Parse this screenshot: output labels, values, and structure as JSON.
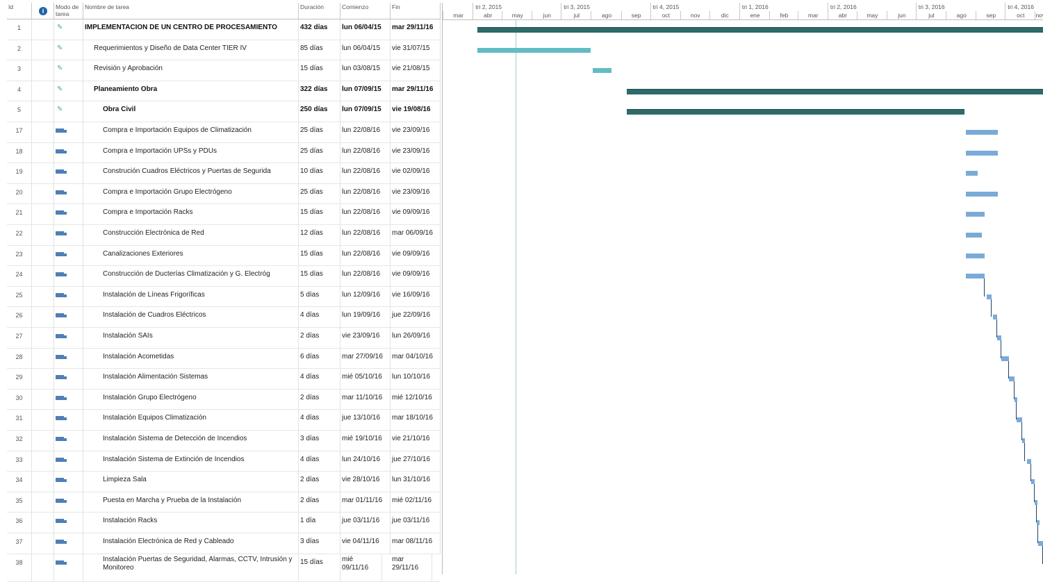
{
  "headers": {
    "id": "Id",
    "info": "",
    "mode": "Modo de tarea",
    "name": "Nombre de tarea",
    "duration": "Duración",
    "start": "Comienzo",
    "end": "Fin"
  },
  "timescale": {
    "quarters": [
      "tri 2, 2015",
      "tri 3, 2015",
      "tri 4, 2015",
      "tri 1, 2016",
      "tri 2, 2016",
      "tri 3, 2016",
      "tri 4, 2016"
    ],
    "months": [
      "mar",
      "abr",
      "may",
      "jun",
      "jul",
      "ago",
      "sep",
      "oct",
      "nov",
      "dic",
      "ene",
      "feb",
      "mar",
      "abr",
      "may",
      "jun",
      "jul",
      "ago",
      "sep",
      "oct",
      "nov"
    ]
  },
  "tasks": [
    {
      "id": "1",
      "mode": "manual",
      "name": "IMPLEMENTACION DE UN CENTRO DE PROCESAMIENTO",
      "duration": "432 días",
      "start": "lun 06/04/15",
      "end": "mar 29/11/16",
      "level": 0,
      "bold": true
    },
    {
      "id": "2",
      "mode": "manual",
      "name": "Requerimientos y Diseño de Data Center TIER IV",
      "duration": "85 días",
      "start": "lun 06/04/15",
      "end": "vie 31/07/15",
      "level": 1,
      "bold": false
    },
    {
      "id": "3",
      "mode": "manual",
      "name": "Revisión y Aprobación",
      "duration": "15 días",
      "start": "lun 03/08/15",
      "end": "vie 21/08/15",
      "level": 1,
      "bold": false
    },
    {
      "id": "4",
      "mode": "manual",
      "name": "Planeamiento Obra",
      "duration": "322 días",
      "start": "lun 07/09/15",
      "end": "mar 29/11/16",
      "level": 1,
      "bold": true
    },
    {
      "id": "5",
      "mode": "manual",
      "name": "Obra Civil",
      "duration": "250 días",
      "start": "lun 07/09/15",
      "end": "vie 19/08/16",
      "level": 2,
      "bold": true
    },
    {
      "id": "17",
      "mode": "auto",
      "name": "Compra e Importación Equipos de Climatización",
      "duration": "25 días",
      "start": "lun 22/08/16",
      "end": "vie 23/09/16",
      "level": 2,
      "bold": false
    },
    {
      "id": "18",
      "mode": "auto",
      "name": "Compra e Importación UPSs y PDUs",
      "duration": "25 días",
      "start": "lun 22/08/16",
      "end": "vie 23/09/16",
      "level": 2,
      "bold": false
    },
    {
      "id": "19",
      "mode": "auto",
      "name": "Construción Cuadros Eléctricos y Puertas de Segurida",
      "duration": "10 días",
      "start": "lun 22/08/16",
      "end": "vie 02/09/16",
      "level": 2,
      "bold": false
    },
    {
      "id": "20",
      "mode": "auto",
      "name": "Compra e Importación Grupo Electrógeno",
      "duration": "25 días",
      "start": "lun 22/08/16",
      "end": "vie 23/09/16",
      "level": 2,
      "bold": false
    },
    {
      "id": "21",
      "mode": "auto",
      "name": "Compra e Importación Racks",
      "duration": "15 días",
      "start": "lun 22/08/16",
      "end": "vie 09/09/16",
      "level": 2,
      "bold": false
    },
    {
      "id": "22",
      "mode": "auto",
      "name": "Construcción Electrónica de Red",
      "duration": "12 días",
      "start": "lun 22/08/16",
      "end": "mar 06/09/16",
      "level": 2,
      "bold": false
    },
    {
      "id": "23",
      "mode": "auto",
      "name": "Canalizaciones Exteriores",
      "duration": "15 días",
      "start": "lun 22/08/16",
      "end": "vie 09/09/16",
      "level": 2,
      "bold": false
    },
    {
      "id": "24",
      "mode": "auto",
      "name": "Construcción de Ducterías Climatización y G. Electróg",
      "duration": "15 días",
      "start": "lun 22/08/16",
      "end": "vie 09/09/16",
      "level": 2,
      "bold": false
    },
    {
      "id": "25",
      "mode": "auto",
      "name": "Instalación de Líneas Frigoríficas",
      "duration": "5 días",
      "start": "lun 12/09/16",
      "end": "vie 16/09/16",
      "level": 2,
      "bold": false
    },
    {
      "id": "26",
      "mode": "auto",
      "name": "Instalación de Cuadros Eléctricos",
      "duration": "4 días",
      "start": "lun 19/09/16",
      "end": "jue 22/09/16",
      "level": 2,
      "bold": false
    },
    {
      "id": "27",
      "mode": "auto",
      "name": "Instalación SAIs",
      "duration": "2 días",
      "start": "vie 23/09/16",
      "end": "lun 26/09/16",
      "level": 2,
      "bold": false
    },
    {
      "id": "28",
      "mode": "auto",
      "name": "Instalación Acometidas",
      "duration": "6 días",
      "start": "mar 27/09/16",
      "end": "mar 04/10/16",
      "level": 2,
      "bold": false
    },
    {
      "id": "29",
      "mode": "auto",
      "name": "Instalación Alimentación Sistemas",
      "duration": "4 días",
      "start": "mié 05/10/16",
      "end": "lun 10/10/16",
      "level": 2,
      "bold": false
    },
    {
      "id": "30",
      "mode": "auto",
      "name": "Instalación Grupo Electrógeno",
      "duration": "2 días",
      "start": "mar 11/10/16",
      "end": "mié 12/10/16",
      "level": 2,
      "bold": false
    },
    {
      "id": "31",
      "mode": "auto",
      "name": "Instalación Equipos Climatización",
      "duration": "4 días",
      "start": "jue 13/10/16",
      "end": "mar 18/10/16",
      "level": 2,
      "bold": false
    },
    {
      "id": "32",
      "mode": "auto",
      "name": "Instalación Sistema de Detección de Incendios",
      "duration": "3 días",
      "start": "mié 19/10/16",
      "end": "vie 21/10/16",
      "level": 2,
      "bold": false
    },
    {
      "id": "33",
      "mode": "auto",
      "name": "Instalación Sistema de Extinción de Incendios",
      "duration": "4 días",
      "start": "lun 24/10/16",
      "end": "jue 27/10/16",
      "level": 2,
      "bold": false
    },
    {
      "id": "34",
      "mode": "auto",
      "name": "Limpieza Sala",
      "duration": "2 días",
      "start": "vie 28/10/16",
      "end": "lun 31/10/16",
      "level": 2,
      "bold": false
    },
    {
      "id": "35",
      "mode": "auto",
      "name": "Puesta en Marcha y Prueba de la Instalación",
      "duration": "2 días",
      "start": "mar 01/11/16",
      "end": "mié 02/11/16",
      "level": 2,
      "bold": false
    },
    {
      "id": "36",
      "mode": "auto",
      "name": "Instalación Racks",
      "duration": "1 día",
      "start": "jue 03/11/16",
      "end": "jue 03/11/16",
      "level": 2,
      "bold": false
    },
    {
      "id": "37",
      "mode": "auto",
      "name": "Instalación Electrónica de Red y Cableado",
      "duration": "3 días",
      "start": "vie 04/11/16",
      "end": "mar 08/11/16",
      "level": 2,
      "bold": false
    },
    {
      "id": "38",
      "mode": "auto",
      "name": "Instalación Puertas de Seguridad, Alarmas, CCTV, Intrusión y Monitoreo",
      "duration": "15 días",
      "start": "mié 09/11/16",
      "end": "mar 29/11/16",
      "level": 2,
      "bold": false
    }
  ],
  "colors": {
    "summary": "#2c6b6a",
    "manual": "#63bcc4",
    "auto": "#7aabd8",
    "link": "#1f3f6e"
  }
}
